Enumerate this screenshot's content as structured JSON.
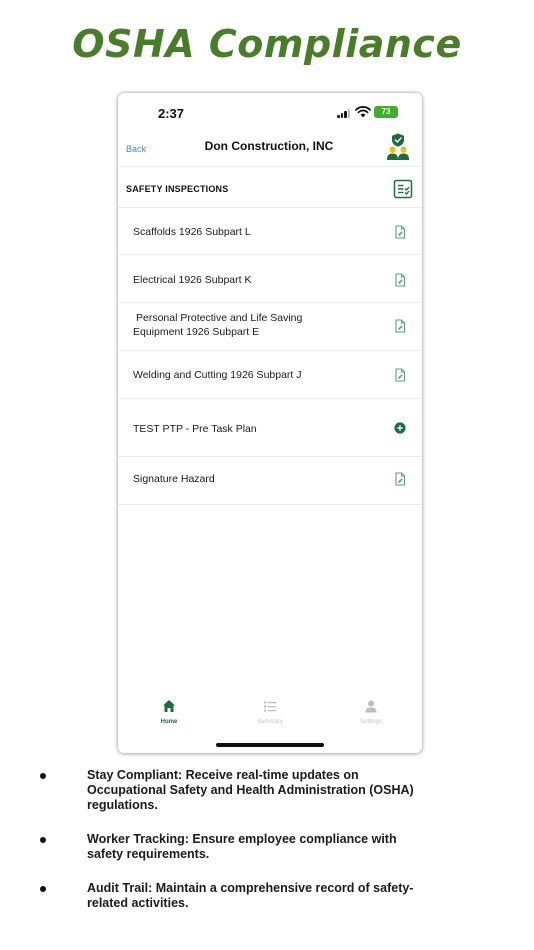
{
  "heading": "OSHA Compliance",
  "status_bar": {
    "time": "2:37",
    "battery": "73"
  },
  "nav": {
    "back_label": "Back",
    "title": "Don Construction, INC"
  },
  "section": {
    "title": "SAFETY INSPECTIONS",
    "icon": "checklist-icon"
  },
  "items": [
    {
      "label_line1": "Scaffolds 1926 Subpart L",
      "label_line2": "",
      "icon": "edit-document-icon"
    },
    {
      "label_line1": "Electrical 1926 Subpart K",
      "label_line2": "",
      "icon": "edit-document-icon"
    },
    {
      "label_line1": "Personal Protective and Life Saving",
      "label_line2": "Equipment 1926 Subpart E",
      "icon": "edit-document-icon"
    },
    {
      "label_line1": "Welding and Cutting 1926 Subpart J",
      "label_line2": "",
      "icon": "edit-document-icon"
    },
    {
      "label_line1": "TEST PTP - Pre Task Plan",
      "label_line2": "",
      "icon": "add-circle-icon"
    },
    {
      "label_line1": "Signature Hazard",
      "label_line2": "",
      "icon": "edit-document-icon"
    }
  ],
  "tabs": [
    {
      "label": "Home",
      "icon": "home-icon",
      "active": true
    },
    {
      "label": "Summary",
      "icon": "list-icon",
      "active": false
    },
    {
      "label": "Settings",
      "icon": "person-icon",
      "active": false
    }
  ],
  "bullets": [
    {
      "line1": "Stay Compliant: Receive real-time updates on",
      "line2": "Occupational Safety and Health Administration (OSHA)",
      "line3": "regulations."
    },
    {
      "line1": "Worker Tracking: Ensure employee compliance with",
      "line2": "safety requirements.",
      "line3": ""
    },
    {
      "line1": "Audit Trail: Maintain a comprehensive record of safety-",
      "line2": "related activities.",
      "line3": ""
    }
  ],
  "colors": {
    "heading_green": "#4a7d2b",
    "primary_green": "#1f6b3a",
    "icon_green": "#2f7d4a",
    "battery_green": "#3fae2a",
    "back_blue": "#3f88c8",
    "avatar_yellow": "#f2c21a",
    "inactive_gray": "#bdbdbd"
  }
}
